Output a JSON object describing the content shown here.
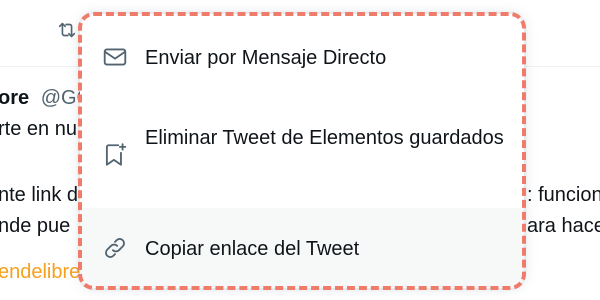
{
  "background": {
    "name": "ore",
    "handle": "@GC",
    "line1": "rte en nu",
    "line2_left": "nte link d",
    "line2_right": ": funcion",
    "line3_left": "nde pue",
    "line3_right": "ara hace",
    "link_text": "endelibre.org/vacantes/desar..."
  },
  "menu": {
    "items": [
      {
        "label": "Enviar por Mensaje Directo",
        "icon": "mail-icon"
      },
      {
        "label": "Eliminar Tweet de Elementos guardados",
        "icon": "bookmark-remove-icon"
      },
      {
        "label": "Copiar enlace del Tweet",
        "icon": "link-icon"
      }
    ]
  },
  "colors": {
    "highlight_border": "#ef7b6b",
    "hover_bg": "#f7f9f9",
    "icon": "#536471",
    "link": "#f4a11b"
  }
}
